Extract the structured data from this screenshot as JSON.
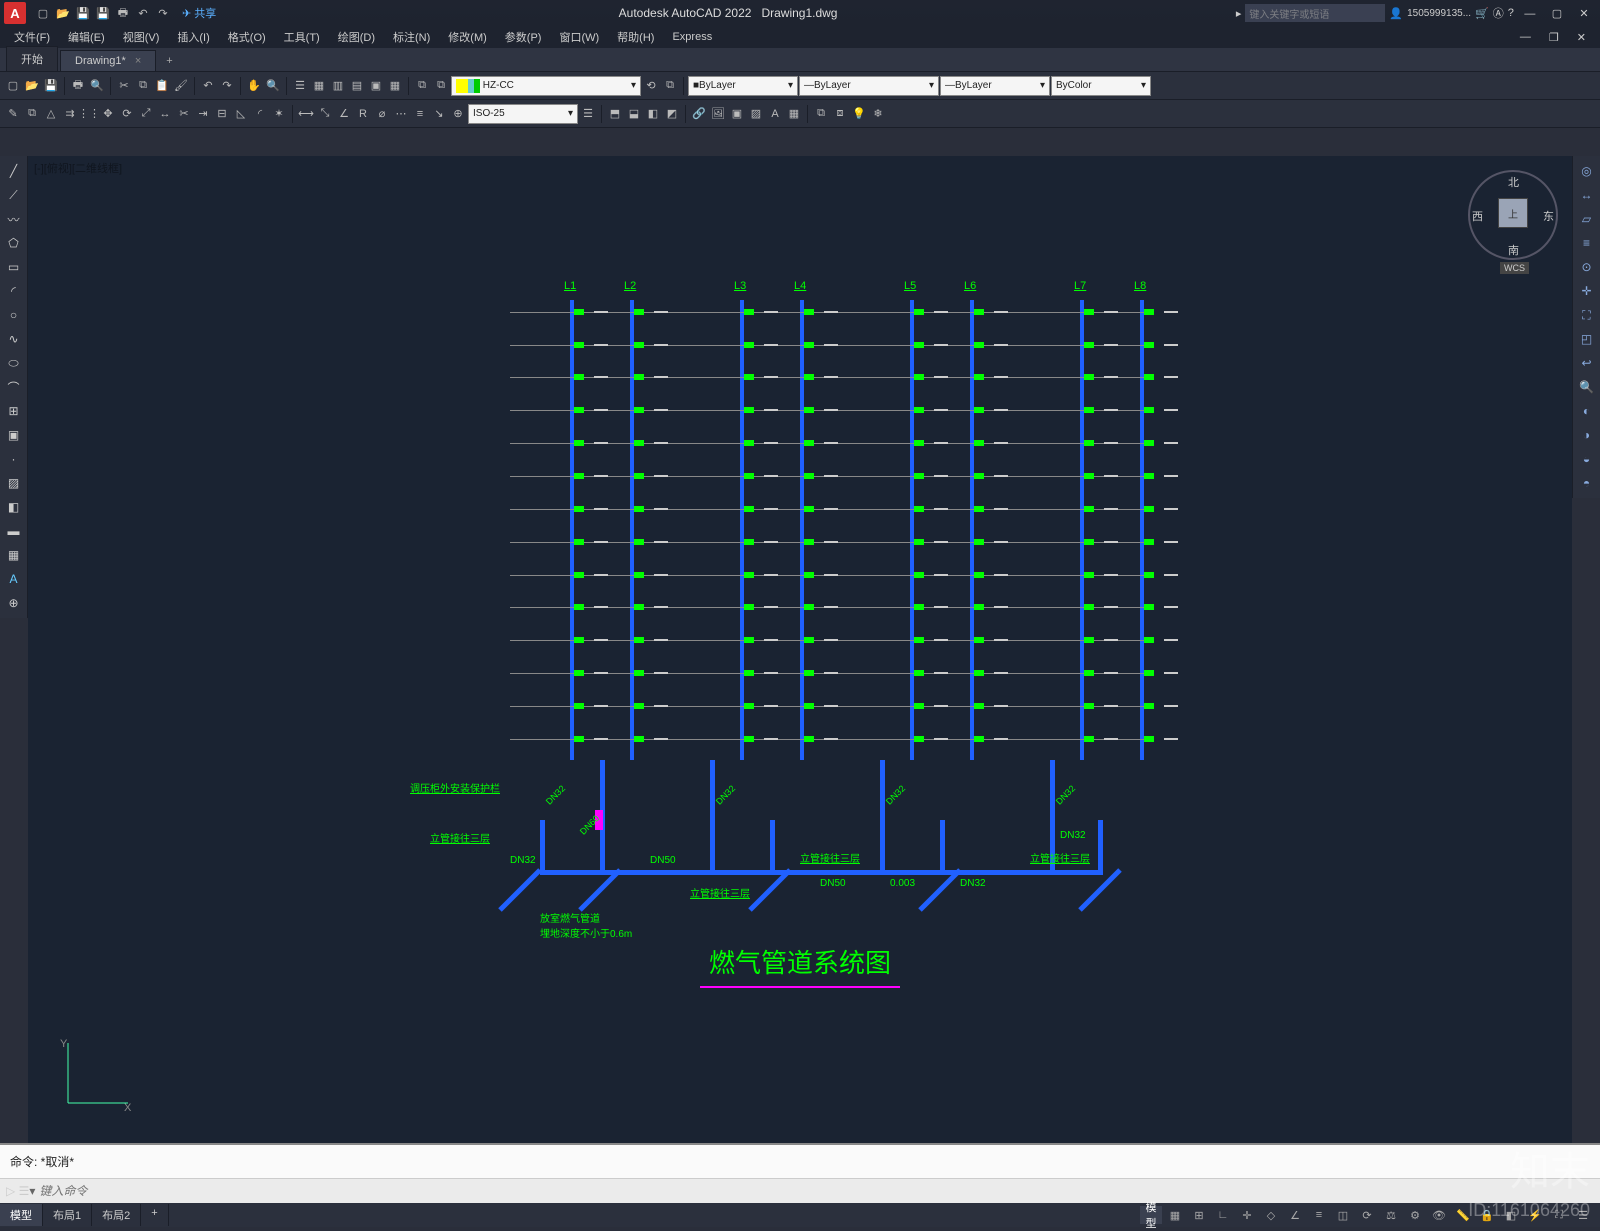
{
  "app": {
    "title_app": "Autodesk AutoCAD 2022",
    "title_doc": "Drawing1.dwg",
    "logo": "A"
  },
  "qat_share": "共享",
  "search": {
    "placeholder": "键入关键字或短语"
  },
  "user": {
    "name": "1505999135..."
  },
  "menus": [
    "文件(F)",
    "编辑(E)",
    "视图(V)",
    "插入(I)",
    "格式(O)",
    "工具(T)",
    "绘图(D)",
    "标注(N)",
    "修改(M)",
    "参数(P)",
    "窗口(W)",
    "帮助(H)",
    "Express"
  ],
  "tabs": {
    "start": "开始",
    "active": "Drawing1*",
    "close": "×",
    "plus": "+"
  },
  "layer": {
    "current": "HZ-CC",
    "prop_layer": "ByLayer",
    "linetype": "ByLayer",
    "lineweight": "ByLayer",
    "color": "ByColor"
  },
  "dimstyle": "ISO-25",
  "viewport_label": "[-][俯视][二维线框]",
  "viewcube": {
    "n": "北",
    "s": "南",
    "e": "东",
    "w": "西",
    "top": "上",
    "wcs": "WCS"
  },
  "ucs": {
    "x": "X",
    "y": "Y"
  },
  "drawing": {
    "title": "燃气管道系统图",
    "risers": [
      "L1",
      "L2",
      "L3",
      "L4",
      "L5",
      "L6",
      "L7",
      "L8"
    ],
    "riser_x": [
      60,
      120,
      230,
      290,
      400,
      460,
      570,
      630
    ],
    "floors": 14,
    "notes": {
      "n1": "调压柜外安装保护栏",
      "n2": "立管接往三层",
      "n3": "放室燃气管道\n埋地深度不小于0.6m",
      "n4": "立管接往三层",
      "n5": "立管接往三层",
      "n6": "立管接往三层"
    },
    "dn": {
      "d32": "DN32",
      "d50": "DN50",
      "d60": "DN60",
      "v003": "0.003"
    }
  },
  "cmd": {
    "history": "命令: *取消*",
    "placeholder": "键入命令"
  },
  "layout_tabs": [
    "模型",
    "布局1",
    "布局2"
  ],
  "status_model": "模型",
  "watermark": {
    "brand": "知末",
    "id": "ID:1161064260"
  }
}
